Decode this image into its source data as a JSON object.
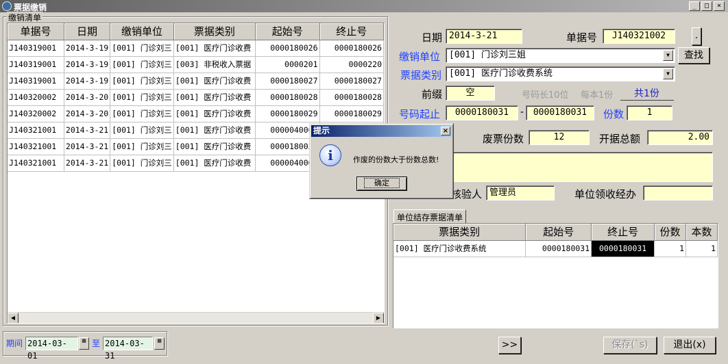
{
  "window": {
    "title": "票据缴销"
  },
  "left_panel": {
    "group_label": "缴销清单",
    "columns": [
      "单据号",
      "日期",
      "缴销单位",
      "票据类别",
      "起始号",
      "终止号"
    ],
    "rows": [
      [
        "J140319001",
        "2014-3-19",
        "[001] 门诊刘三",
        "[001] 医疗门诊收费",
        "0000180026",
        "0000180026"
      ],
      [
        "J140319001",
        "2014-3-19",
        "[001] 门诊刘三",
        "[003] 非税收入票据",
        "0000201",
        "0000220"
      ],
      [
        "J140319001",
        "2014-3-19",
        "[001] 门诊刘三",
        "[001] 医疗门诊收费",
        "0000180027",
        "0000180027"
      ],
      [
        "J140320002",
        "2014-3-20",
        "[001] 门诊刘三",
        "[001] 医疗门诊收费",
        "0000180028",
        "0000180028"
      ],
      [
        "J140320002",
        "2014-3-20",
        "[001] 门诊刘三",
        "[001] 医疗门诊收费",
        "0000180029",
        "0000180029"
      ],
      [
        "J140321001",
        "2014-3-21",
        "[001] 门诊刘三",
        "[001] 医疗门诊收费",
        "0000040001",
        ""
      ],
      [
        "J140321001",
        "2014-3-21",
        "[001] 门诊刘三",
        "[001] 医疗门诊收费",
        "0000180030",
        ""
      ],
      [
        "J140321001",
        "2014-3-21",
        "[001] 门诊刘三",
        "[001] 医疗门诊收费",
        "0000040001",
        ""
      ]
    ]
  },
  "period": {
    "label": "期间",
    "from": "2014-03-01",
    "to_label": "至",
    "to": "2014-03-31"
  },
  "form": {
    "date_label": "日期",
    "date_value": "2014-3-21",
    "doc_no_label": "单据号",
    "doc_no_value": "J140321002",
    "dot_button": ".",
    "unit_label": "缴销单位",
    "unit_value": "[001] 门诊刘三姐",
    "find_button": "查找",
    "category_label": "票据类别",
    "category_value": "[001] 医疗门诊收费系统",
    "prefix_label": "前缀",
    "prefix_value": "空",
    "code_len_label": "号码长10位",
    "per_book_label": "每本1份",
    "total_label": "共1份",
    "range_label": "号码起止",
    "range_from": "0000180031",
    "range_dash": "-",
    "range_to": "0000180031",
    "count_label": "份数",
    "count_value": "1",
    "void_count_label": "废票份数",
    "void_count_value": "12",
    "total_amount_label": "开据总额",
    "total_amount_value": "2.00",
    "verifier_label": "核验人",
    "verifier_value": "管理员",
    "unit_handler_label": "单位领收经办",
    "unit_handler_value": ""
  },
  "stock": {
    "tab_label": "单位结存票据清单",
    "columns": [
      "票据类别",
      "起始号",
      "终止号",
      "份数",
      "本数"
    ],
    "rows": [
      [
        "[001] 医疗门诊收费系统",
        "0000180031",
        "0000180031",
        "1",
        "1"
      ]
    ]
  },
  "buttons": {
    "next": ">>",
    "save": "保存(`s)",
    "exit": "退出(x)"
  },
  "dialog": {
    "title": "提示",
    "message": "作废的份数大于份数总数!",
    "ok": "确定"
  }
}
